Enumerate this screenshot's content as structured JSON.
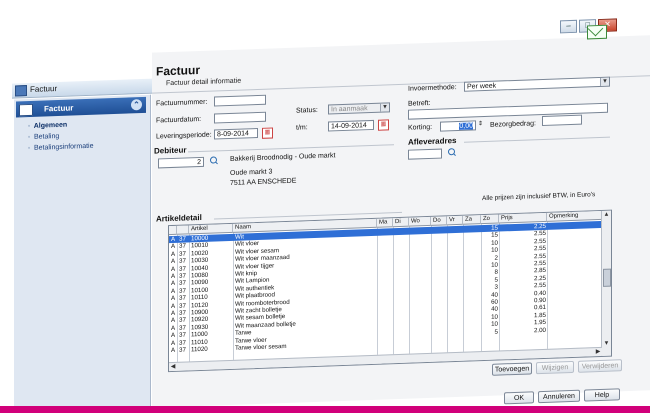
{
  "window": {
    "title": "Factuur",
    "buttons": {
      "minimize": "–",
      "maximize": "□",
      "close": "✕"
    }
  },
  "sidebar": {
    "header": "Factuur",
    "items": [
      {
        "label": "Algemeen",
        "active": true
      },
      {
        "label": "Betaling",
        "active": false
      },
      {
        "label": "Betalingsinformatie",
        "active": false
      }
    ]
  },
  "header": {
    "title": "Factuur",
    "subtitle": "Factuur detail informatie"
  },
  "form": {
    "factuurnummer_label": "Factuurnummer:",
    "factuurnummer_value": "",
    "factuurdatum_label": "Factuurdatum:",
    "factuurdatum_value": "",
    "status_label": "Status:",
    "status_value": "In aanmaak",
    "leveringsperiode_label": "Leveringsperiode:",
    "leveringsperiode_value": "8-09-2014",
    "tm_label": "t/m:",
    "tm_value": "14-09-2014",
    "invoermethode_label": "Invoermethode:",
    "invoermethode_value": "Per week",
    "betreft_label": "Betreft:",
    "betreft_value": "",
    "korting_label": "Korting:",
    "korting_value": "0,00",
    "bezorgbedrag_label": "Bezorgbedrag:",
    "bezorgbedrag_value": ""
  },
  "debiteur": {
    "heading": "Debiteur",
    "number": "2",
    "name": "Bakkerij Broodnodig - Oude markt",
    "address_line1": "Oude markt 3",
    "address_line2": "7511 AA   ENSCHEDE"
  },
  "afleveradres": {
    "heading": "Afleveradres",
    "value": ""
  },
  "artikeldetail": {
    "heading": "Artikeldetail",
    "note": "Alle prijzen zijn inclusief BTW, in Euro's",
    "columns": [
      "",
      "",
      "Artikel",
      "Naam",
      "Ma",
      "Di",
      "Wo",
      "Do",
      "Vr",
      "Za",
      "Zo",
      "Prijs",
      "Opmerking"
    ],
    "rows": [
      {
        "a": "A",
        "g": "37",
        "artikel": "10000",
        "naam": "Wit",
        "qty": "15",
        "prijs": "2.25",
        "selected": true
      },
      {
        "a": "A",
        "g": "37",
        "artikel": "10010",
        "naam": "Wit vloer",
        "qty": "15",
        "prijs": "2.55"
      },
      {
        "a": "A",
        "g": "37",
        "artikel": "10020",
        "naam": "Wit vloer sesam",
        "qty": "10",
        "prijs": "2.55"
      },
      {
        "a": "A",
        "g": "37",
        "artikel": "10030",
        "naam": "Wit vloer maanzaad",
        "qty": "10",
        "prijs": "2.55"
      },
      {
        "a": "A",
        "g": "37",
        "artikel": "10040",
        "naam": "Wit vloer tijger",
        "qty": "2",
        "prijs": "2.55"
      },
      {
        "a": "A",
        "g": "37",
        "artikel": "10080",
        "naam": "Wit knip",
        "qty": "10",
        "prijs": "2.55"
      },
      {
        "a": "A",
        "g": "37",
        "artikel": "10090",
        "naam": "Wit Lampion",
        "qty": "8",
        "prijs": "2.85"
      },
      {
        "a": "A",
        "g": "37",
        "artikel": "10100",
        "naam": "Wit authentiek",
        "qty": "5",
        "prijs": "2.25"
      },
      {
        "a": "A",
        "g": "37",
        "artikel": "10110",
        "naam": "Wit plaatbrood",
        "qty": "3",
        "prijs": "2.55"
      },
      {
        "a": "A",
        "g": "37",
        "artikel": "10120",
        "naam": "Wit roomboterbrood",
        "qty": "40",
        "prijs": "0.40"
      },
      {
        "a": "A",
        "g": "37",
        "artikel": "10900",
        "naam": "Wit zacht bolletje",
        "qty": "60",
        "prijs": "0.90"
      },
      {
        "a": "A",
        "g": "37",
        "artikel": "10920",
        "naam": "Wit sesam bolletje",
        "qty": "40",
        "prijs": "0.61"
      },
      {
        "a": "A",
        "g": "37",
        "artikel": "10930",
        "naam": "Wit maanzaad bolletje",
        "qty": "10",
        "prijs": "1.85"
      },
      {
        "a": "A",
        "g": "37",
        "artikel": "11000",
        "naam": "Tarwe",
        "qty": "10",
        "prijs": "1.95"
      },
      {
        "a": "A",
        "g": "37",
        "artikel": "11010",
        "naam": "Tarwe vloer",
        "qty": "5",
        "prijs": "2.00"
      },
      {
        "a": "A",
        "g": "37",
        "artikel": "11020",
        "naam": "Tarwe vloer sesam",
        "qty": "",
        "prijs": ""
      }
    ]
  },
  "buttons": {
    "toevoegen": "Toevoegen",
    "wijzigen": "Wijzigen",
    "verwijderen": "Verwijderen",
    "ok": "OK",
    "annuleren": "Annuleren",
    "help": "Help"
  },
  "colors": {
    "accent": "#2f6fd6",
    "brand_bar": "#d1007a",
    "sidebar_header": "#1f4f95"
  },
  "icons": {
    "calendar": "calendar-icon",
    "search": "search-icon",
    "email": "envelope-icon"
  }
}
